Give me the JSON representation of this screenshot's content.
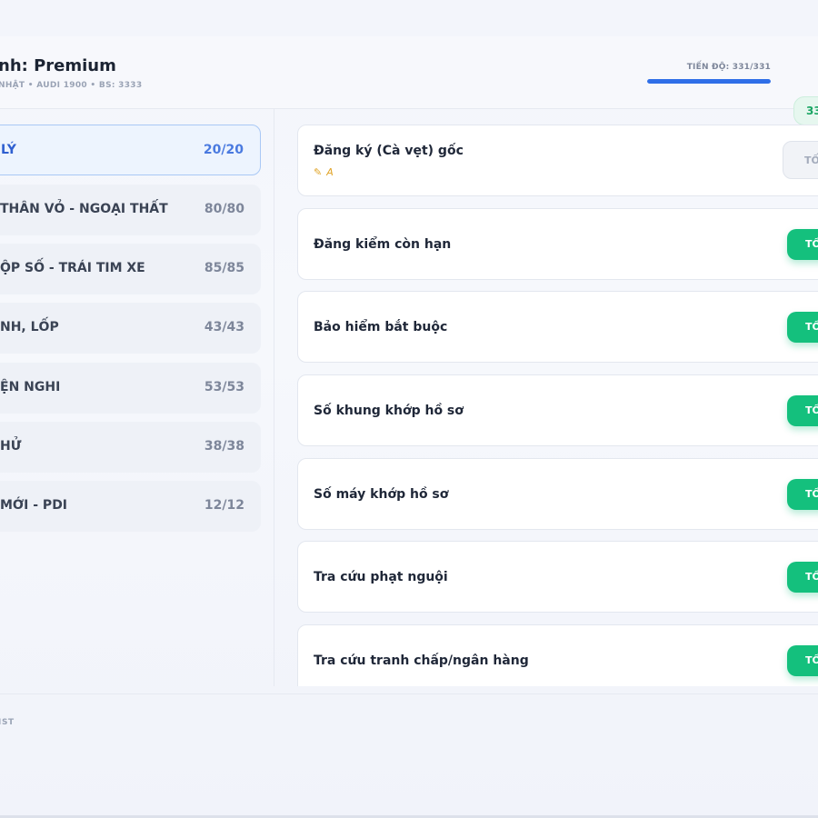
{
  "header": {
    "title": "nh: Premium",
    "subtitle": "NHẬT • AUDI 1900 • BS: 3333",
    "progress_label": "TIẾN ĐỘ: 331/331",
    "progress_fraction": 1.0,
    "count_badge": "33"
  },
  "colors": {
    "accent": "#2f6fe8",
    "good": "#14c07d",
    "note": "#e0a326"
  },
  "sidebar": {
    "categories": [
      {
        "label": "LÝ",
        "count": "20/20",
        "active": true
      },
      {
        "label": "THÂN VỎ - NGOẠI THẤT",
        "count": "80/80"
      },
      {
        "label": "ỘP SỐ - TRÁI TIM XE",
        "count": "85/85"
      },
      {
        "label": "NH, LỐP",
        "count": "43/43"
      },
      {
        "label": "ỆN NGHI",
        "count": "53/53"
      },
      {
        "label": "HỬ",
        "count": "38/38"
      },
      {
        "label": "MỚI - PDI",
        "count": "12/12"
      }
    ]
  },
  "items": [
    {
      "title": "Đăng ký (Cà vẹt) gốc",
      "note_icon": "pencil-icon",
      "note": "A",
      "status": "TỐ",
      "status_style": "neutral"
    },
    {
      "title": "Đăng kiểm còn hạn",
      "status": "TỐ"
    },
    {
      "title": "Bảo hiểm bắt buộc",
      "status": "TỐ"
    },
    {
      "title": "Số khung khớp hồ sơ",
      "status": "TỐ"
    },
    {
      "title": "Số máy khớp hồ sơ",
      "status": "TỐ"
    },
    {
      "title": "Tra cứu phạt nguội",
      "status": "TỐ"
    },
    {
      "title": "Tra cứu tranh chấp/ngân hàng",
      "status": "TỐ"
    }
  ],
  "footer": {
    "text": "IST"
  }
}
